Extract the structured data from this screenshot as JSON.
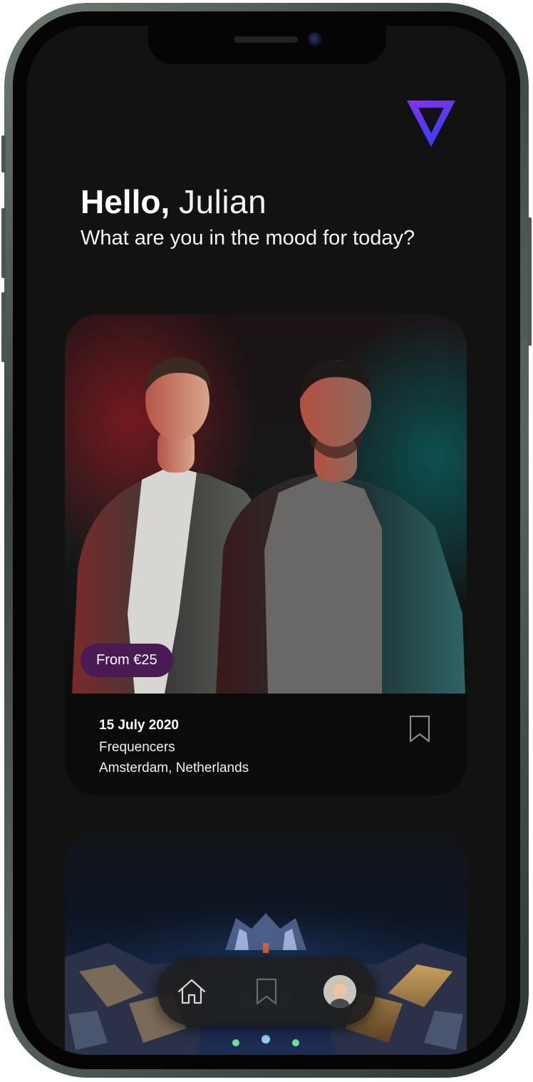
{
  "app": {
    "logo_icon": "triangle-logo-icon",
    "accent_gradient": [
      "#7b2ff7",
      "#3a3ff0"
    ]
  },
  "greeting": {
    "hello": "Hello,",
    "name": "Julian",
    "subtitle": "What are you in the mood for today?"
  },
  "events": [
    {
      "price": "From €25",
      "date": "15 July 2020",
      "artist": "Frequencers",
      "location": "Amsterdam, Netherlands",
      "bookmark_icon": "bookmark-icon",
      "badge_color": "#4a1a55"
    },
    {
      "image_icon": "festival-stage-photo"
    }
  ],
  "tab_bar": {
    "items": [
      {
        "icon": "home-icon",
        "active": true
      },
      {
        "icon": "bookmark-icon",
        "active": false
      },
      {
        "icon": "avatar",
        "active": false
      }
    ]
  }
}
